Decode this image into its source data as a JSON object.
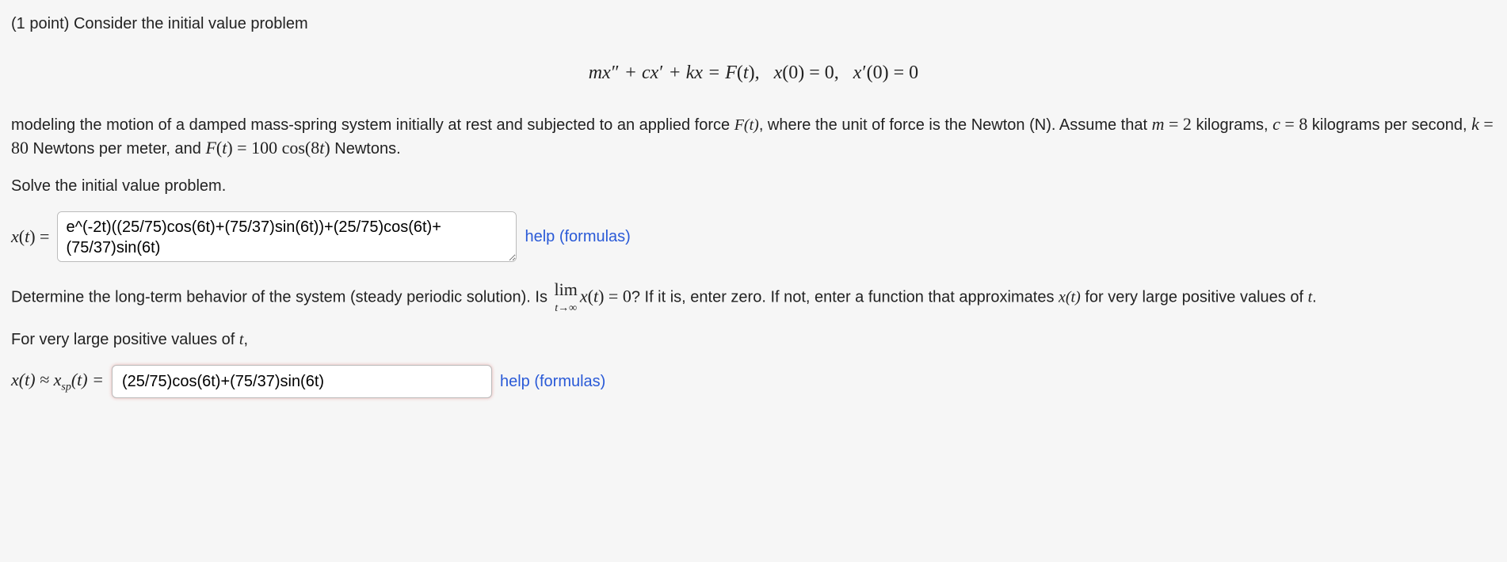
{
  "problem": {
    "points_label": "(1 point)",
    "intro1": "Consider the initial value problem",
    "equation_html": "mx<span class='prime'>&Prime;</span> + cx<span class='prime'>&prime;</span> + kx = F<span class='upright'>(</span>t<span class='upright'>)</span>,&nbsp;&nbsp; x<span class='upright'>(0) = 0,</span>&nbsp;&nbsp; x<span class='prime'>&prime;</span><span class='upright'>(0) = 0</span>",
    "desc_part1": "modeling the motion of a damped mass-spring system initially at rest and subjected to an applied force ",
    "desc_force": "F(t)",
    "desc_part2": ", where the unit of force is the Newton (N). Assume that ",
    "m_eq": "m = 2",
    "m_unit": " kilograms, ",
    "c_eq": "c = 8",
    "c_unit": " kilograms per second, ",
    "k_eq": "k = 80",
    "k_unit": " Newtons per meter, and ",
    "F_eq": "F(t) = 100 cos(8t)",
    "F_unit": " Newtons."
  },
  "solve_prompt": "Solve the initial value problem.",
  "answer1": {
    "lhs": "x(t) = ",
    "value": "e^(-2t)((25/75)cos(6t)+(75/37)sin(6t))+(25/75)cos(6t)+(75/37)sin(6t)",
    "help": "help (formulas)"
  },
  "longterm": {
    "part1": "Determine the long-term behavior of the system (steady periodic solution). Is ",
    "lim_top": "lim",
    "lim_bot": "t→∞",
    "lim_expr": " x(t) = 0",
    "part2": "? If it is, enter zero. If not, enter a function that approximates ",
    "xt": "x(t)",
    "part3": " for very large positive values of ",
    "tvar": "t",
    "part4": "."
  },
  "for_large": "For very large positive values of ",
  "for_large_t": "t",
  "for_large_comma": ",",
  "answer2": {
    "lhs_html": "x(t) ≈ x<span class='sub'>sp</span>(t) = ",
    "value": "(25/75)cos(6t)+(75/37)sin(6t)",
    "help": "help (formulas)"
  }
}
